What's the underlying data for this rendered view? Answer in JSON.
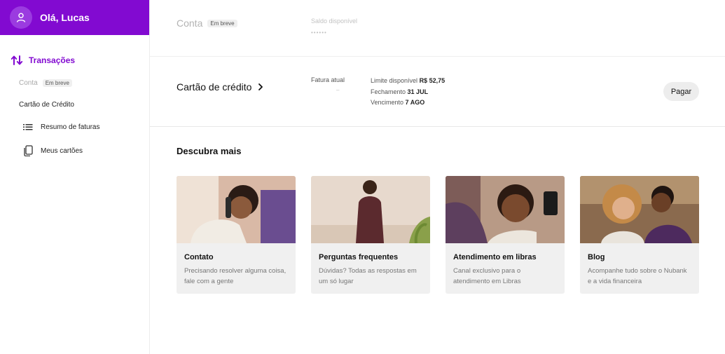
{
  "sidebar": {
    "greeting": "Olá, Lucas",
    "section_label": "Transações",
    "conta_label": "Conta",
    "conta_badge": "Em breve",
    "cartao_label": "Cartão de Crédito",
    "items": [
      {
        "label": "Resumo de faturas",
        "icon": "list-icon"
      },
      {
        "label": "Meus cartões",
        "icon": "cards-icon"
      }
    ]
  },
  "conta": {
    "title": "Conta",
    "badge": "Em breve",
    "saldo_label": "Saldo disponível",
    "saldo_value": "••••••"
  },
  "cartao": {
    "title": "Cartão de crédito",
    "fatura_label": "Fatura atual",
    "fatura_value": "–",
    "limite_label": "Limite disponível",
    "limite_value": "R$ 52,75",
    "fechamento_label": "Fechamento",
    "fechamento_value": "31 JUL",
    "vencimento_label": "Vencimento",
    "vencimento_value": "7 AGO",
    "pay_button": "Pagar"
  },
  "descubra": {
    "title": "Descubra mais",
    "tiles": [
      {
        "title": "Contato",
        "description": "Precisando resolver alguma coisa, fale com a gente"
      },
      {
        "title": "Perguntas frequentes",
        "description": "Dúvidas? Todas as respostas em um só lugar"
      },
      {
        "title": "Atendimento em libras",
        "description": "Canal exclusivo para o atendimento em Libras"
      },
      {
        "title": "Blog",
        "description": "Acompanhe tudo sobre o Nubank e a vida financeira"
      }
    ]
  },
  "colors": {
    "brand": "#820ad1",
    "tile_bg": "#f0f0f0"
  }
}
